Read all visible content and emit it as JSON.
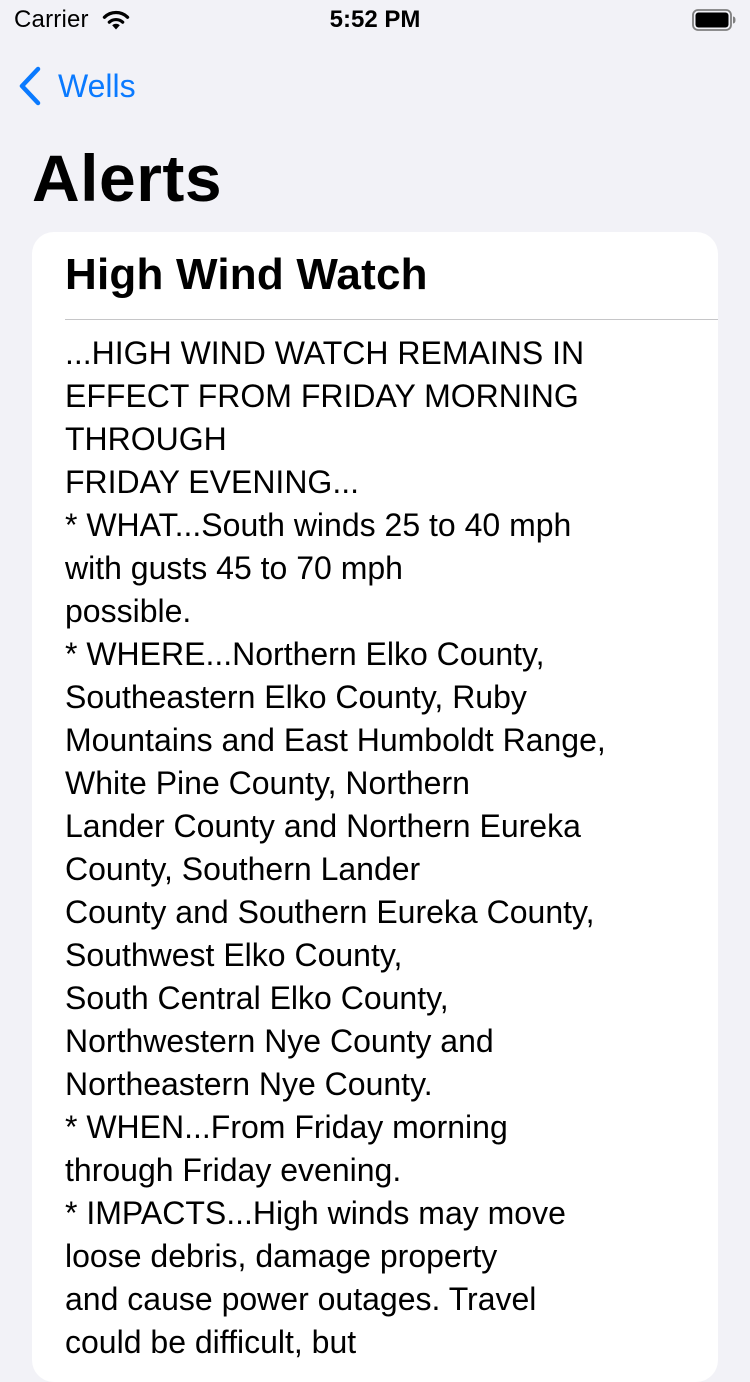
{
  "status_bar": {
    "carrier": "Carrier",
    "time": "5:52 PM",
    "icons": [
      "wifi-icon",
      "battery-icon"
    ]
  },
  "nav": {
    "back_label": "Wells",
    "back_icon": "chevron-left-icon",
    "title": "Alerts",
    "accent_color": "#0a7aff"
  },
  "alert": {
    "title": "High Wind Watch",
    "lines": [
      "...HIGH WIND WATCH REMAINS IN",
      "EFFECT FROM FRIDAY MORNING",
      "THROUGH",
      "FRIDAY EVENING...",
      "* WHAT...South winds 25 to 40 mph",
      "with gusts 45 to 70 mph",
      "possible.",
      "* WHERE...Northern Elko County,",
      "Southeastern Elko County, Ruby",
      "Mountains and East Humboldt Range,",
      "White Pine County, Northern",
      "Lander County and Northern Eureka",
      "County, Southern Lander",
      "County and Southern Eureka County,",
      "Southwest Elko County,",
      "South Central Elko County,",
      "Northwestern Nye County and",
      "Northeastern Nye County.",
      "* WHEN...From Friday morning",
      "through Friday evening.",
      "* IMPACTS...High winds may move",
      "loose debris, damage property",
      "and cause power outages. Travel",
      "could be difficult, but"
    ]
  }
}
